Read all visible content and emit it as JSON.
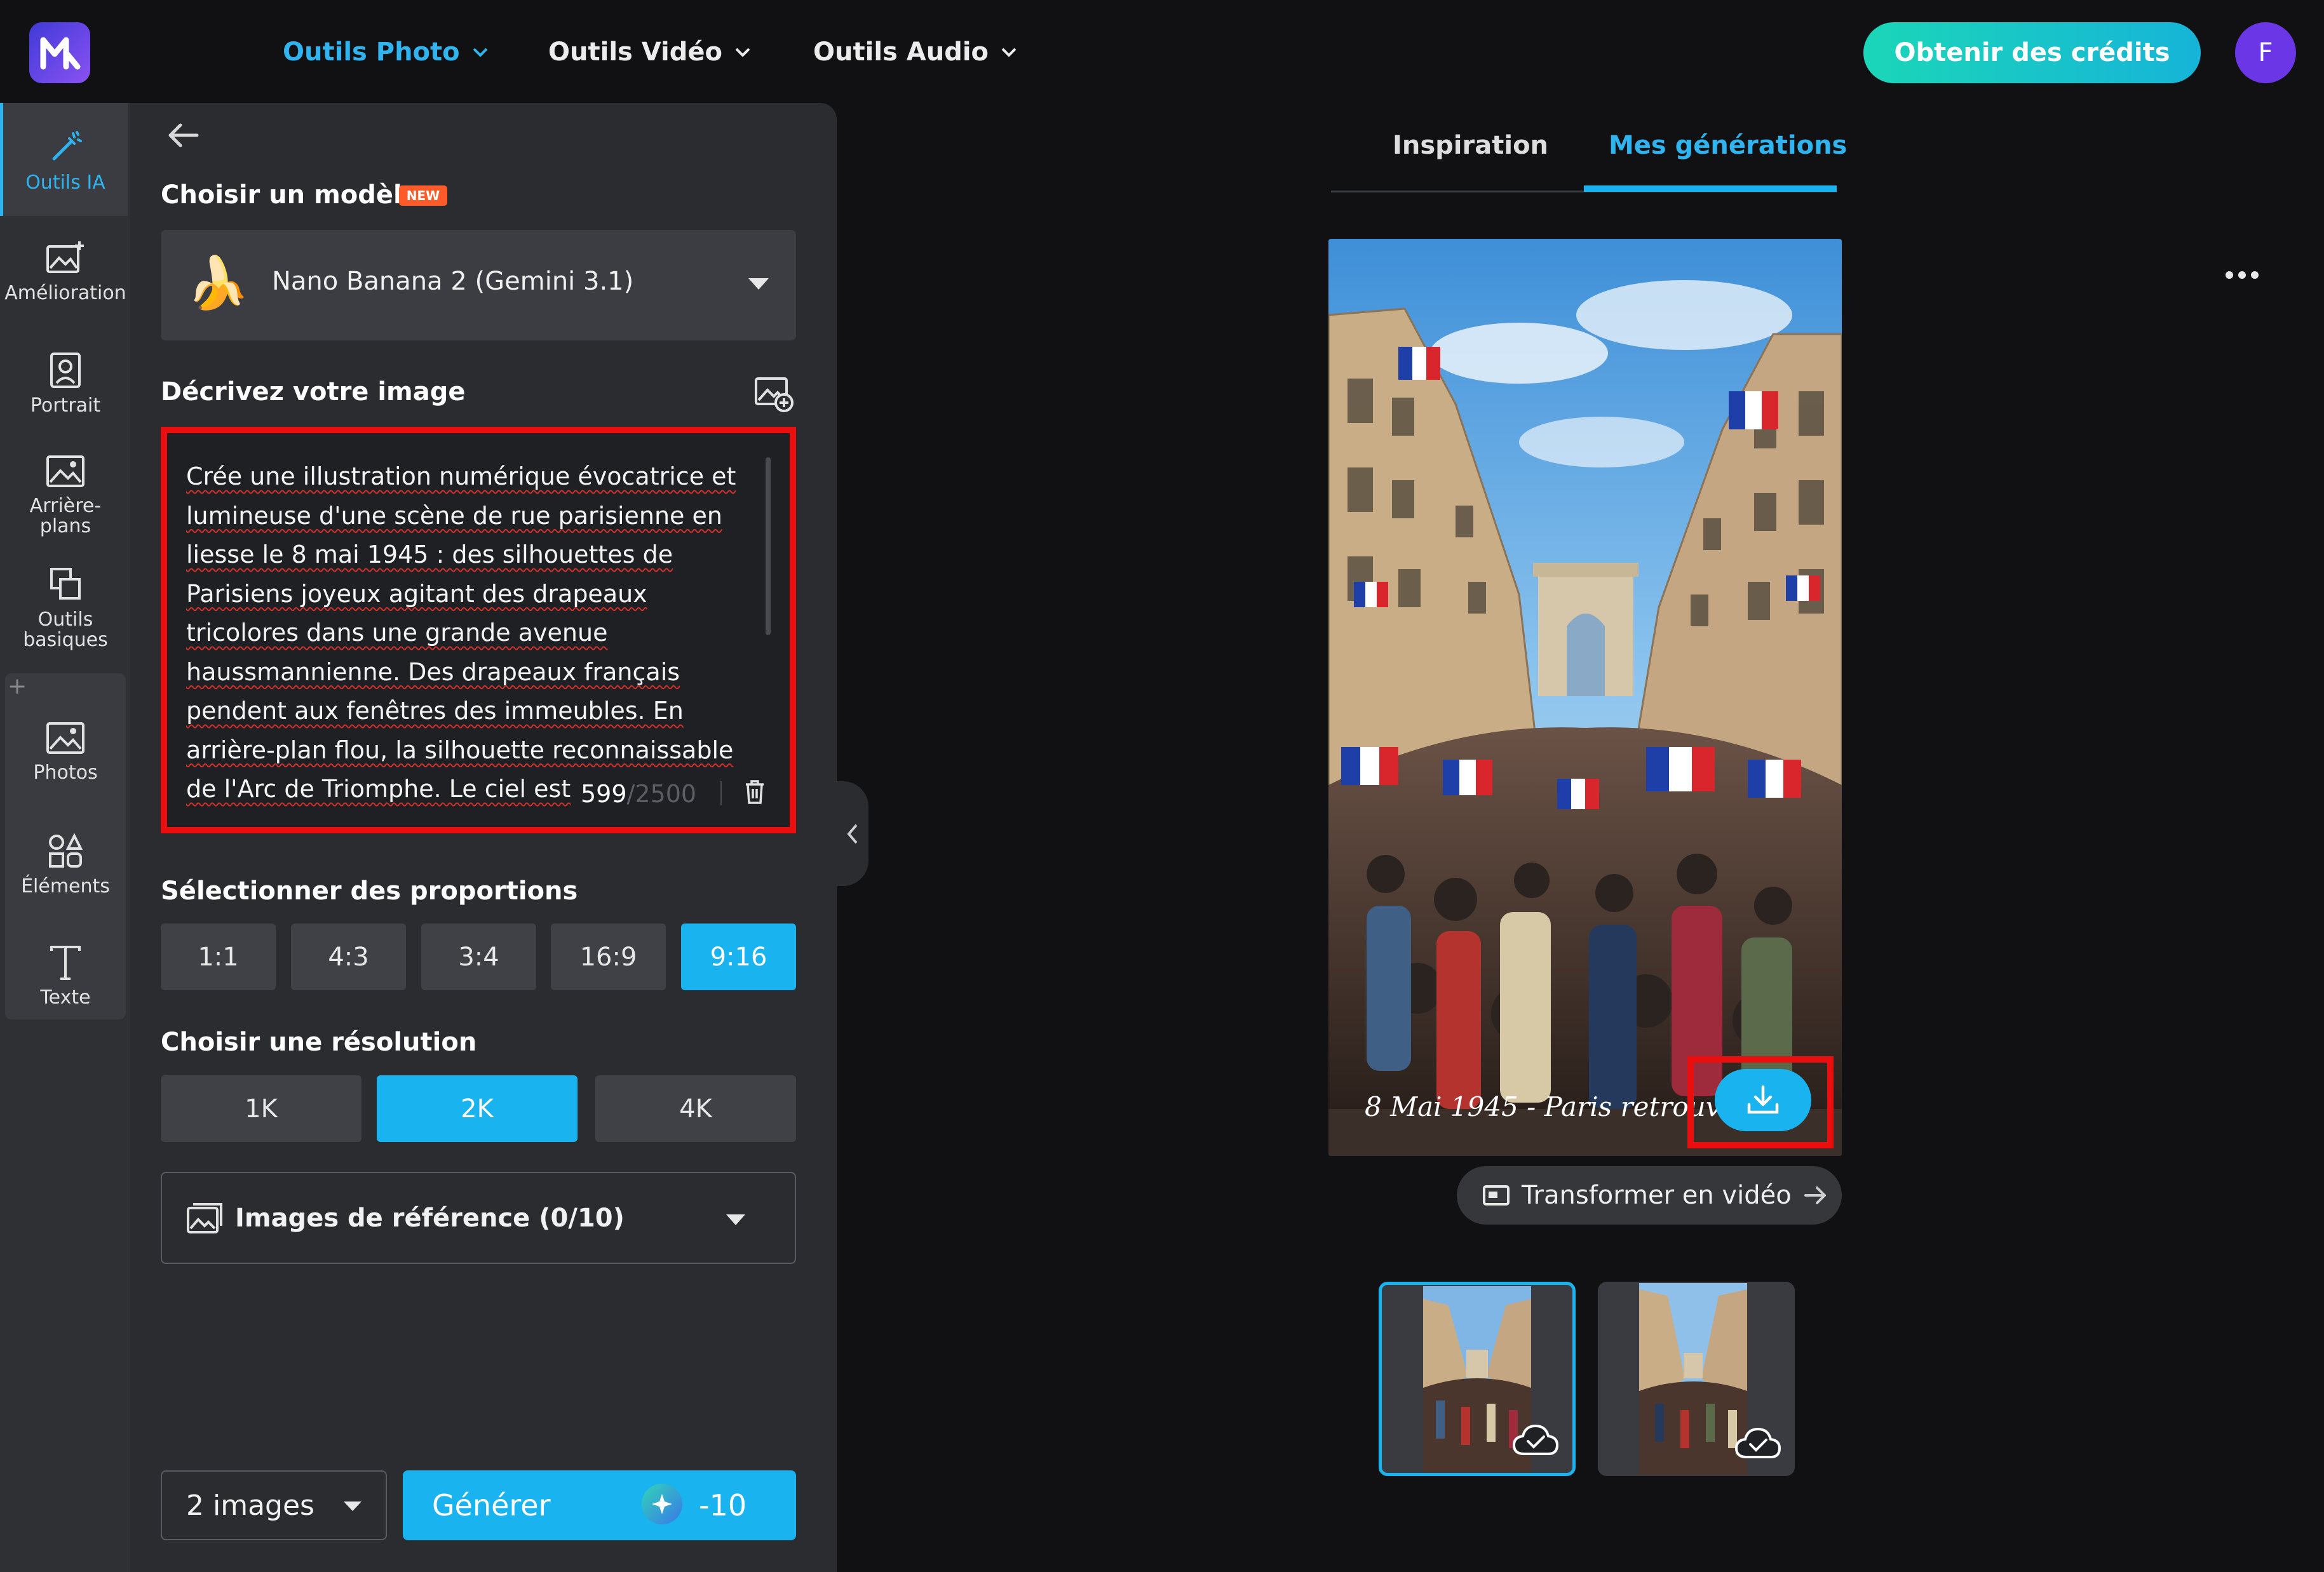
{
  "nav": {
    "items": [
      {
        "label": "Outils Photo",
        "active": true
      },
      {
        "label": "Outils Vidéo",
        "active": false
      },
      {
        "label": "Outils Audio",
        "active": false
      }
    ],
    "credits_button": "Obtenir des crédits",
    "avatar_letter": "F"
  },
  "rail": {
    "items": [
      {
        "label": "Outils IA",
        "icon": "magic-wand-icon",
        "active": true
      },
      {
        "label": "Amélioration",
        "icon": "image-enhance-icon"
      },
      {
        "label": "Portrait",
        "icon": "portrait-icon"
      },
      {
        "label": "Arrière-\nplans",
        "icon": "background-icon"
      },
      {
        "label": "Outils\nbasiques",
        "icon": "basic-tools-icon"
      },
      {
        "label": "Photos",
        "icon": "photos-icon"
      },
      {
        "label": "Éléments",
        "icon": "elements-icon"
      },
      {
        "label": "Texte",
        "icon": "text-icon"
      }
    ],
    "plus": "+"
  },
  "panel": {
    "model_title": "Choisir un modèle",
    "new_badge": "NEW",
    "model_name": "Nano Banana 2 (Gemini 3.1)",
    "model_emoji": "🍌",
    "describe_title": "Décrivez votre image",
    "prompt": "Crée une illustration numérique évocatrice et lumineuse d'une scène de rue parisienne en liesse le 8 mai 1945 : des silhouettes de Parisiens joyeux agitant des drapeaux tricolores dans une grande avenue haussmannienne. Des drapeaux français pendent aux fenêtres des immeubles. En arrière-plan flou, la silhouette reconnaissable de l'Arc de Triomphe. Le ciel est",
    "char_count": "599",
    "char_max": "/2500",
    "ratio_title": "Sélectionner des proportions",
    "ratios": [
      {
        "label": "1:1",
        "selected": false
      },
      {
        "label": "4:3",
        "selected": false
      },
      {
        "label": "3:4",
        "selected": false
      },
      {
        "label": "16:9",
        "selected": false
      },
      {
        "label": "9:16",
        "selected": true
      }
    ],
    "res_title": "Choisir une résolution",
    "resolutions": [
      {
        "label": "1K",
        "selected": false
      },
      {
        "label": "2K",
        "selected": true
      },
      {
        "label": "4K",
        "selected": false
      }
    ],
    "reference_images": "Images de référence (0/10)",
    "image_count": "2 images",
    "generate_label": "Générer",
    "generate_cost": "-10"
  },
  "right": {
    "tabs": [
      {
        "label": "Inspiration",
        "active": false
      },
      {
        "label": "Mes générations",
        "active": true
      }
    ],
    "caption": "8 Mai 1945 - Paris retrouve sa",
    "to_video": "Transformer en vidéo"
  },
  "colors": {
    "accent": "#19b4ef",
    "highlight": "#ea0e0e",
    "background": "#111113",
    "panel": "#2b2c30"
  }
}
